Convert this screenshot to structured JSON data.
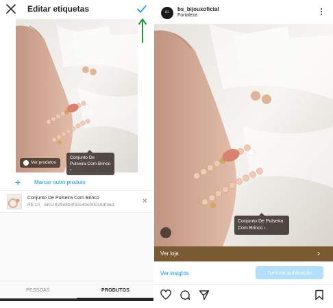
{
  "left_panel": {
    "header": {
      "title": "Editar etiquetas"
    },
    "photo": {
      "tags_pill": "Ver produtos",
      "product_tag": "Conjunto De Pulseira Com Brinco"
    },
    "add_product": {
      "label": "Marcar outro produto"
    },
    "product": {
      "name": "Conjunto De Pulseira Com Brinco",
      "meta": "R$ 10 · SKU 629e8b4f30c49e00019df36a"
    },
    "tabs": [
      {
        "label": "PESSOAS",
        "active": false
      },
      {
        "label": "PRODUTOS",
        "active": true
      }
    ],
    "accent_color": "#0095f6",
    "annotation_arrow_color": "#1e9a37"
  },
  "right_panel": {
    "header": {
      "username": "bs_bijouxoficial",
      "location": "Fortaleza",
      "avatar_text": "BS"
    },
    "photo": {
      "product_tag": "Conjunto De Pulseira Com Brinco"
    },
    "shop_bar": {
      "label": "Ver loja",
      "color": "#7a5a32"
    },
    "insights": {
      "label": "Ver insights"
    },
    "promote": {
      "label": "Turbinar publicação"
    },
    "actions": [
      "heart-icon",
      "comment-icon",
      "share-icon",
      "bookmark-icon"
    ]
  }
}
